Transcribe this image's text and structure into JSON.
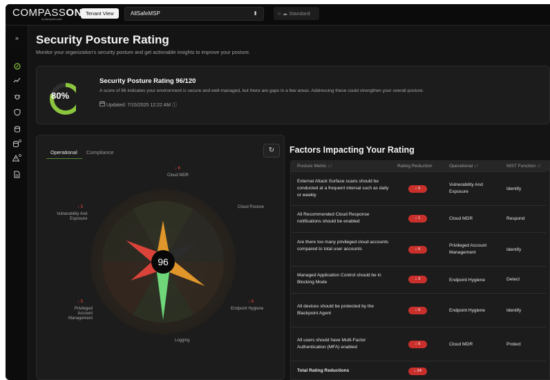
{
  "topbar": {
    "logo_main": "COMPASS",
    "logo_bold": "ONE",
    "logo_sub": "by blackpoint cyber",
    "tenant_view_label": "Tenant View",
    "tenant_name": "AllSafeMSP",
    "mode_label": "Standard"
  },
  "sidebar": {
    "items": [
      {
        "icon": "collapse-icon"
      },
      {
        "icon": "compass-icon"
      },
      {
        "icon": "trend-icon"
      },
      {
        "icon": "bug-icon"
      },
      {
        "icon": "shield-icon"
      },
      {
        "icon": "database-icon"
      },
      {
        "icon": "database-stack-icon"
      },
      {
        "icon": "alert-icon"
      },
      {
        "icon": "document-icon"
      }
    ]
  },
  "page": {
    "title": "Security Posture Rating",
    "subtitle": "Monitor your organization's security posture and get actionable insights to improve your posture."
  },
  "rating": {
    "percent_label": "80%",
    "percent": 80,
    "title": "Security Posture Rating 96/120",
    "description": "A score of 96 indicates your environment is secure and well-managed, but there are gaps in a few areas. Addressing these could strengthen your overall posture.",
    "updated": "Updated: 7/15/2025 12:22 AM",
    "accent_color": "#8cc63f"
  },
  "radar": {
    "tabs": [
      "Operational",
      "Compliance"
    ],
    "score": "96",
    "axes": [
      {
        "label": "Cloud MDR",
        "reduction": "↓ 6"
      },
      {
        "label": "Cloud Posture",
        "reduction": ""
      },
      {
        "label": "Endpoint Hygiene",
        "reduction": "↓ 8"
      },
      {
        "label": "Logging",
        "reduction": ""
      },
      {
        "label": "Privileged\nAccount\nManagement",
        "reduction": "↓ 5"
      },
      {
        "label": "Vulnerability And\nExposure",
        "reduction": "↓ 5"
      }
    ]
  },
  "factors": {
    "title": "Factors Impacting Your Rating",
    "columns": [
      "Posture Metric ↓↑",
      "Rating Reduction",
      "Operational ↓↑",
      "NIST Function ↓↑"
    ],
    "rows": [
      {
        "metric": "External Attack Surface scans should be conducted at a frequent interval such as daily or weekly",
        "reduction": "↓ 5",
        "operational": "Vulnerability And Exposure",
        "nist": "Identify"
      },
      {
        "metric": "All Recommended Cloud Response notifications should be enabled",
        "reduction": "↓ 1",
        "operational": "Cloud MDR",
        "nist": "Respond"
      },
      {
        "metric": "Are there too many privileged cloud accounts compared to total user accounts",
        "reduction": "↓ 5",
        "operational": "Privileged Account Management",
        "nist": "Identify"
      },
      {
        "metric": "Managed Application Control should be in Blocking Mode",
        "reduction": "↓ 3",
        "operational": "Endpoint Hygiene",
        "nist": "Detect"
      },
      {
        "metric": "All devices should be protected by the Blackpoint Agent",
        "reduction": "↓ 5",
        "operational": "Endpoint Hygiene",
        "nist": "Identify"
      },
      {
        "metric": "All users should have Multi-Factor Authentication (MFA) enabled",
        "reduction": "↓ 5",
        "operational": "Cloud MDR",
        "nist": "Protect"
      }
    ],
    "total_label": "Total Rating Reductions",
    "total_value": "↓ 24"
  }
}
